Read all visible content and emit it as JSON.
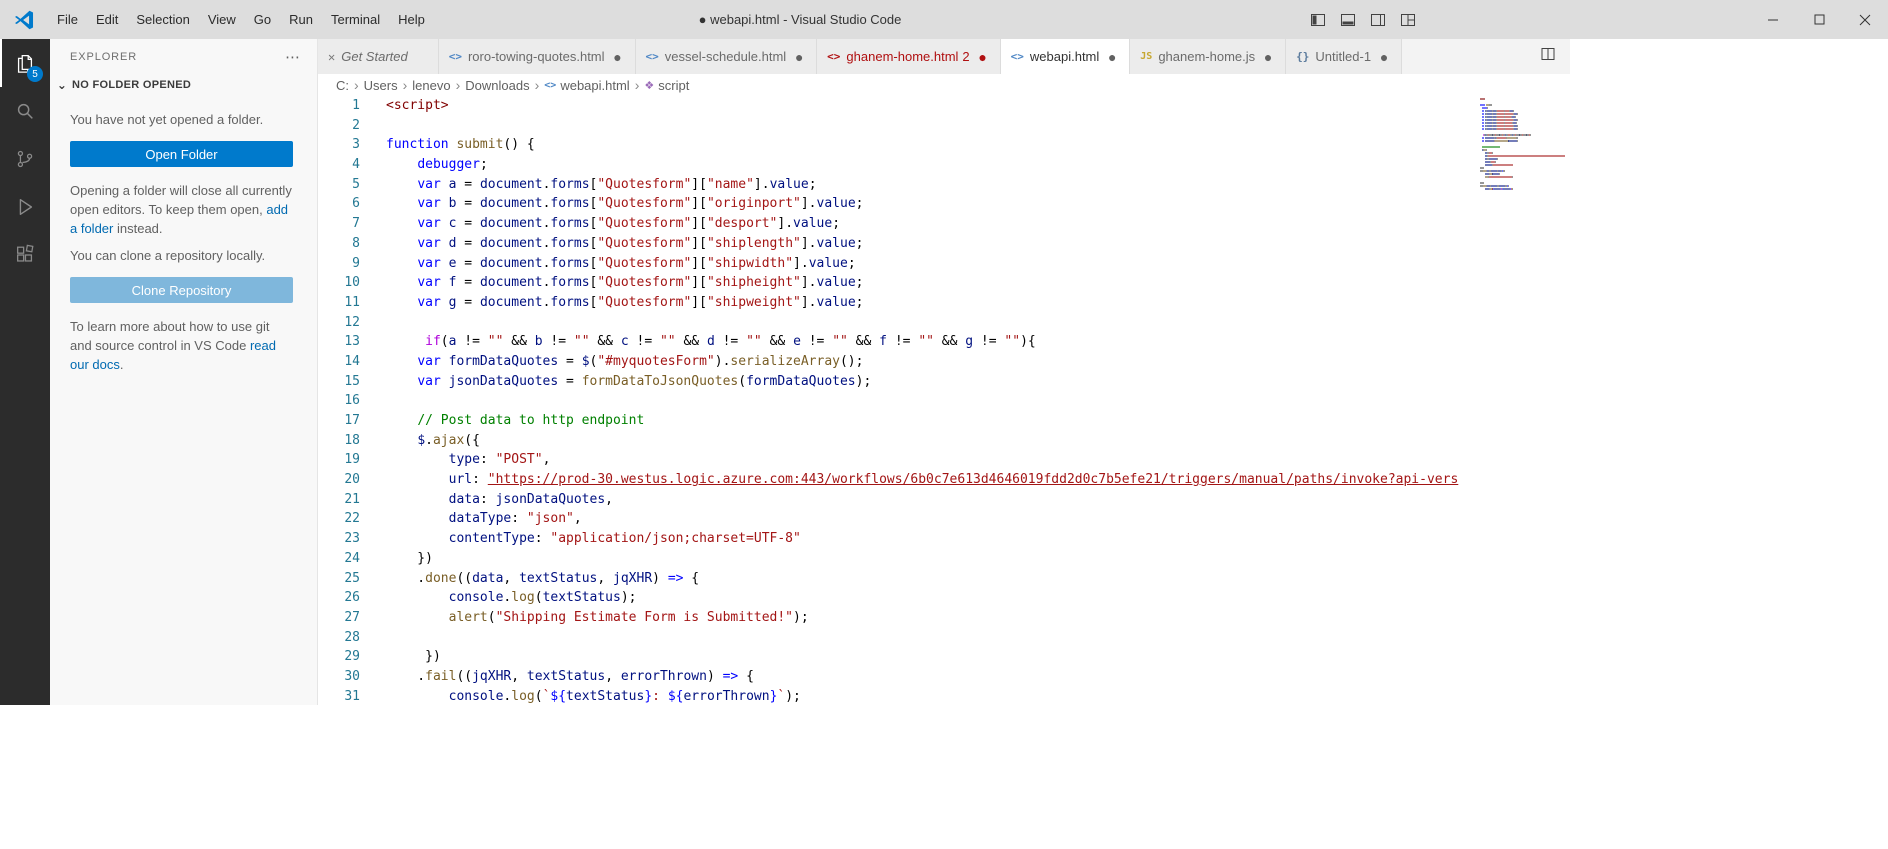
{
  "colors": {
    "accent": "#007acc",
    "secondary_button": "#7fb7dc",
    "link": "#006ab1",
    "error": "#b01011"
  },
  "syntax_colors": {
    "pl": "#424242",
    "kw": "#0000ff",
    "ctl": "#af00db",
    "fn": "#795e26",
    "var": "#001080",
    "str": "#a31515",
    "cm": "#008000",
    "tag": "#800000",
    "url": "#a31515",
    "ln": "#237893"
  },
  "icons": {
    "close": "✕",
    "html": "<>",
    "js": "JS",
    "untitled": "{}",
    "modified_dot": "●",
    "chevron_down": "⌄",
    "more": "⋯",
    "breadcrumb_sep": "›",
    "symbol": "❖"
  },
  "title_bar": {
    "menus": [
      "File",
      "Edit",
      "Selection",
      "View",
      "Go",
      "Run",
      "Terminal",
      "Help"
    ],
    "window_title": "● webapi.html - Visual Studio Code"
  },
  "activity_bar": {
    "badge": "5",
    "items": [
      "explorer",
      "search",
      "source-control",
      "run-and-debug",
      "extensions"
    ]
  },
  "sidebar": {
    "header": "EXPLORER",
    "section": "NO FOLDER OPENED",
    "no_folder_text": "You have not yet opened a folder.",
    "open_folder_button": "Open Folder",
    "keep_open_text_1": "Opening a folder will close all currently open editors. To keep them open, ",
    "add_folder_link": "add a folder",
    "keep_open_text_2": " instead.",
    "clone_text": "You can clone a repository locally.",
    "clone_button": "Clone Repository",
    "learn_text_1": "To learn more about how to use git and source control in VS Code ",
    "docs_link": "read our docs",
    "learn_text_2": "."
  },
  "tabs": [
    {
      "label": "Get Started",
      "icon": "close",
      "italic": true,
      "modified": false,
      "active": false
    },
    {
      "label": "roro-towing-quotes.html",
      "icon": "html",
      "modified": true,
      "active": false
    },
    {
      "label": "vessel-schedule.html",
      "icon": "html",
      "modified": true,
      "active": false
    },
    {
      "label": "ghanem-home.html",
      "badge": "2",
      "icon": "html",
      "modified": true,
      "active": false,
      "error": true
    },
    {
      "label": "webapi.html",
      "icon": "html",
      "modified": true,
      "active": true
    },
    {
      "label": "ghanem-home.js",
      "icon": "js",
      "modified": true,
      "active": false
    },
    {
      "label": "Untitled-1",
      "icon": "untitled",
      "modified": true,
      "active": false
    }
  ],
  "breadcrumb": [
    {
      "label": "C:"
    },
    {
      "label": "Users"
    },
    {
      "label": "lenevo"
    },
    {
      "label": "Downloads"
    },
    {
      "label": "webapi.html",
      "icon": "html"
    },
    {
      "label": "script",
      "icon": "symbol"
    }
  ],
  "editor": {
    "lines": [
      [
        [
          "tag",
          "<script>"
        ]
      ],
      [],
      [
        [
          "kw",
          "function"
        ],
        [
          "pl",
          " "
        ],
        [
          "fn",
          "submit"
        ],
        [
          "pl",
          "() {"
        ]
      ],
      [
        [
          "pl",
          "    "
        ],
        [
          "kw",
          "debugger"
        ],
        [
          "pl",
          ";"
        ]
      ],
      [
        [
          "pl",
          "    "
        ],
        [
          "kw",
          "var"
        ],
        [
          "pl",
          " "
        ],
        [
          "var",
          "a"
        ],
        [
          "pl",
          " = "
        ],
        [
          "var",
          "document"
        ],
        [
          "pl",
          "."
        ],
        [
          "var",
          "forms"
        ],
        [
          "pl",
          "["
        ],
        [
          "str",
          "\"Quotesform\""
        ],
        [
          "pl",
          "]["
        ],
        [
          "str",
          "\"name\""
        ],
        [
          "pl",
          "]."
        ],
        [
          "var",
          "value"
        ],
        [
          "pl",
          ";"
        ]
      ],
      [
        [
          "pl",
          "    "
        ],
        [
          "kw",
          "var"
        ],
        [
          "pl",
          " "
        ],
        [
          "var",
          "b"
        ],
        [
          "pl",
          " = "
        ],
        [
          "var",
          "document"
        ],
        [
          "pl",
          "."
        ],
        [
          "var",
          "forms"
        ],
        [
          "pl",
          "["
        ],
        [
          "str",
          "\"Quotesform\""
        ],
        [
          "pl",
          "]["
        ],
        [
          "str",
          "\"originport\""
        ],
        [
          "pl",
          "]."
        ],
        [
          "var",
          "value"
        ],
        [
          "pl",
          ";"
        ]
      ],
      [
        [
          "pl",
          "    "
        ],
        [
          "kw",
          "var"
        ],
        [
          "pl",
          " "
        ],
        [
          "var",
          "c"
        ],
        [
          "pl",
          " = "
        ],
        [
          "var",
          "document"
        ],
        [
          "pl",
          "."
        ],
        [
          "var",
          "forms"
        ],
        [
          "pl",
          "["
        ],
        [
          "str",
          "\"Quotesform\""
        ],
        [
          "pl",
          "]["
        ],
        [
          "str",
          "\"desport\""
        ],
        [
          "pl",
          "]."
        ],
        [
          "var",
          "value"
        ],
        [
          "pl",
          ";"
        ]
      ],
      [
        [
          "pl",
          "    "
        ],
        [
          "kw",
          "var"
        ],
        [
          "pl",
          " "
        ],
        [
          "var",
          "d"
        ],
        [
          "pl",
          " = "
        ],
        [
          "var",
          "document"
        ],
        [
          "pl",
          "."
        ],
        [
          "var",
          "forms"
        ],
        [
          "pl",
          "["
        ],
        [
          "str",
          "\"Quotesform\""
        ],
        [
          "pl",
          "]["
        ],
        [
          "str",
          "\"shiplength\""
        ],
        [
          "pl",
          "]."
        ],
        [
          "var",
          "value"
        ],
        [
          "pl",
          ";"
        ]
      ],
      [
        [
          "pl",
          "    "
        ],
        [
          "kw",
          "var"
        ],
        [
          "pl",
          " "
        ],
        [
          "var",
          "e"
        ],
        [
          "pl",
          " = "
        ],
        [
          "var",
          "document"
        ],
        [
          "pl",
          "."
        ],
        [
          "var",
          "forms"
        ],
        [
          "pl",
          "["
        ],
        [
          "str",
          "\"Quotesform\""
        ],
        [
          "pl",
          "]["
        ],
        [
          "str",
          "\"shipwidth\""
        ],
        [
          "pl",
          "]."
        ],
        [
          "var",
          "value"
        ],
        [
          "pl",
          ";"
        ]
      ],
      [
        [
          "pl",
          "    "
        ],
        [
          "kw",
          "var"
        ],
        [
          "pl",
          " "
        ],
        [
          "var",
          "f"
        ],
        [
          "pl",
          " = "
        ],
        [
          "var",
          "document"
        ],
        [
          "pl",
          "."
        ],
        [
          "var",
          "forms"
        ],
        [
          "pl",
          "["
        ],
        [
          "str",
          "\"Quotesform\""
        ],
        [
          "pl",
          "]["
        ],
        [
          "str",
          "\"shipheight\""
        ],
        [
          "pl",
          "]."
        ],
        [
          "var",
          "value"
        ],
        [
          "pl",
          ";"
        ]
      ],
      [
        [
          "pl",
          "    "
        ],
        [
          "kw",
          "var"
        ],
        [
          "pl",
          " "
        ],
        [
          "var",
          "g"
        ],
        [
          "pl",
          " = "
        ],
        [
          "var",
          "document"
        ],
        [
          "pl",
          "."
        ],
        [
          "var",
          "forms"
        ],
        [
          "pl",
          "["
        ],
        [
          "str",
          "\"Quotesform\""
        ],
        [
          "pl",
          "]["
        ],
        [
          "str",
          "\"shipweight\""
        ],
        [
          "pl",
          "]."
        ],
        [
          "var",
          "value"
        ],
        [
          "pl",
          ";"
        ]
      ],
      [],
      [
        [
          "pl",
          "     "
        ],
        [
          "ctl",
          "if"
        ],
        [
          "pl",
          "("
        ],
        [
          "var",
          "a"
        ],
        [
          "pl",
          " != "
        ],
        [
          "str",
          "\"\""
        ],
        [
          "pl",
          " && "
        ],
        [
          "var",
          "b"
        ],
        [
          "pl",
          " != "
        ],
        [
          "str",
          "\"\""
        ],
        [
          "pl",
          " && "
        ],
        [
          "var",
          "c"
        ],
        [
          "pl",
          " != "
        ],
        [
          "str",
          "\"\""
        ],
        [
          "pl",
          " && "
        ],
        [
          "var",
          "d"
        ],
        [
          "pl",
          " != "
        ],
        [
          "str",
          "\"\""
        ],
        [
          "pl",
          " && "
        ],
        [
          "var",
          "e"
        ],
        [
          "pl",
          " != "
        ],
        [
          "str",
          "\"\""
        ],
        [
          "pl",
          " && "
        ],
        [
          "var",
          "f"
        ],
        [
          "pl",
          " != "
        ],
        [
          "str",
          "\"\""
        ],
        [
          "pl",
          " && "
        ],
        [
          "var",
          "g"
        ],
        [
          "pl",
          " != "
        ],
        [
          "str",
          "\"\""
        ],
        [
          "pl",
          "){"
        ]
      ],
      [
        [
          "pl",
          "    "
        ],
        [
          "kw",
          "var"
        ],
        [
          "pl",
          " "
        ],
        [
          "var",
          "formDataQuotes"
        ],
        [
          "pl",
          " = "
        ],
        [
          "var",
          "$"
        ],
        [
          "pl",
          "("
        ],
        [
          "str",
          "\"#myquotesForm\""
        ],
        [
          "pl",
          ")."
        ],
        [
          "fn",
          "serializeArray"
        ],
        [
          "pl",
          "();"
        ]
      ],
      [
        [
          "pl",
          "    "
        ],
        [
          "kw",
          "var"
        ],
        [
          "pl",
          " "
        ],
        [
          "var",
          "jsonDataQuotes"
        ],
        [
          "pl",
          " = "
        ],
        [
          "fn",
          "formDataToJsonQuotes"
        ],
        [
          "pl",
          "("
        ],
        [
          "var",
          "formDataQuotes"
        ],
        [
          "pl",
          ");"
        ]
      ],
      [],
      [
        [
          "pl",
          "    "
        ],
        [
          "cm",
          "// Post data to http endpoint"
        ]
      ],
      [
        [
          "pl",
          "    "
        ],
        [
          "var",
          "$"
        ],
        [
          "pl",
          "."
        ],
        [
          "fn",
          "ajax"
        ],
        [
          "pl",
          "({"
        ]
      ],
      [
        [
          "pl",
          "        "
        ],
        [
          "var",
          "type"
        ],
        [
          "pl",
          ": "
        ],
        [
          "str",
          "\"POST\""
        ],
        [
          "pl",
          ","
        ]
      ],
      [
        [
          "pl",
          "        "
        ],
        [
          "var",
          "url"
        ],
        [
          "pl",
          ": "
        ],
        [
          "url",
          "\"https://prod-30.westus.logic.azure.com:443/workflows/6b0c7e613d4646019fdd2d0c7b5efe21/triggers/manual/paths/invoke?api-vers"
        ]
      ],
      [
        [
          "pl",
          "        "
        ],
        [
          "var",
          "data"
        ],
        [
          "pl",
          ": "
        ],
        [
          "var",
          "jsonDataQuotes"
        ],
        [
          "pl",
          ","
        ]
      ],
      [
        [
          "pl",
          "        "
        ],
        [
          "var",
          "dataType"
        ],
        [
          "pl",
          ": "
        ],
        [
          "str",
          "\"json\""
        ],
        [
          "pl",
          ","
        ]
      ],
      [
        [
          "pl",
          "        "
        ],
        [
          "var",
          "contentType"
        ],
        [
          "pl",
          ": "
        ],
        [
          "str",
          "\"application/json;charset=UTF-8\""
        ]
      ],
      [
        [
          "pl",
          "    })"
        ]
      ],
      [
        [
          "pl",
          "    ."
        ],
        [
          "fn",
          "done"
        ],
        [
          "pl",
          "(("
        ],
        [
          "var",
          "data"
        ],
        [
          "pl",
          ", "
        ],
        [
          "var",
          "textStatus"
        ],
        [
          "pl",
          ", "
        ],
        [
          "var",
          "jqXHR"
        ],
        [
          "pl",
          ") "
        ],
        [
          "kw",
          "=>"
        ],
        [
          "pl",
          " {"
        ]
      ],
      [
        [
          "pl",
          "        "
        ],
        [
          "var",
          "console"
        ],
        [
          "pl",
          "."
        ],
        [
          "fn",
          "log"
        ],
        [
          "pl",
          "("
        ],
        [
          "var",
          "textStatus"
        ],
        [
          "pl",
          ");"
        ]
      ],
      [
        [
          "pl",
          "        "
        ],
        [
          "fn",
          "alert"
        ],
        [
          "pl",
          "("
        ],
        [
          "str",
          "\"Shipping Estimate Form is Submitted!\""
        ],
        [
          "pl",
          ");"
        ]
      ],
      [],
      [
        [
          "pl",
          "     })"
        ]
      ],
      [
        [
          "pl",
          "    ."
        ],
        [
          "fn",
          "fail"
        ],
        [
          "pl",
          "(("
        ],
        [
          "var",
          "jqXHR"
        ],
        [
          "pl",
          ", "
        ],
        [
          "var",
          "textStatus"
        ],
        [
          "pl",
          ", "
        ],
        [
          "var",
          "errorThrown"
        ],
        [
          "pl",
          ") "
        ],
        [
          "kw",
          "=>"
        ],
        [
          "pl",
          " {"
        ]
      ],
      [
        [
          "pl",
          "        "
        ],
        [
          "var",
          "console"
        ],
        [
          "pl",
          "."
        ],
        [
          "fn",
          "log"
        ],
        [
          "pl",
          "("
        ],
        [
          "str",
          "`"
        ],
        [
          "kw",
          "${"
        ],
        [
          "var",
          "textStatus"
        ],
        [
          "kw",
          "}"
        ],
        [
          "str",
          ": "
        ],
        [
          "kw",
          "${"
        ],
        [
          "var",
          "errorThrown"
        ],
        [
          "kw",
          "}"
        ],
        [
          "str",
          "`"
        ],
        [
          "pl",
          ");"
        ]
      ]
    ]
  }
}
